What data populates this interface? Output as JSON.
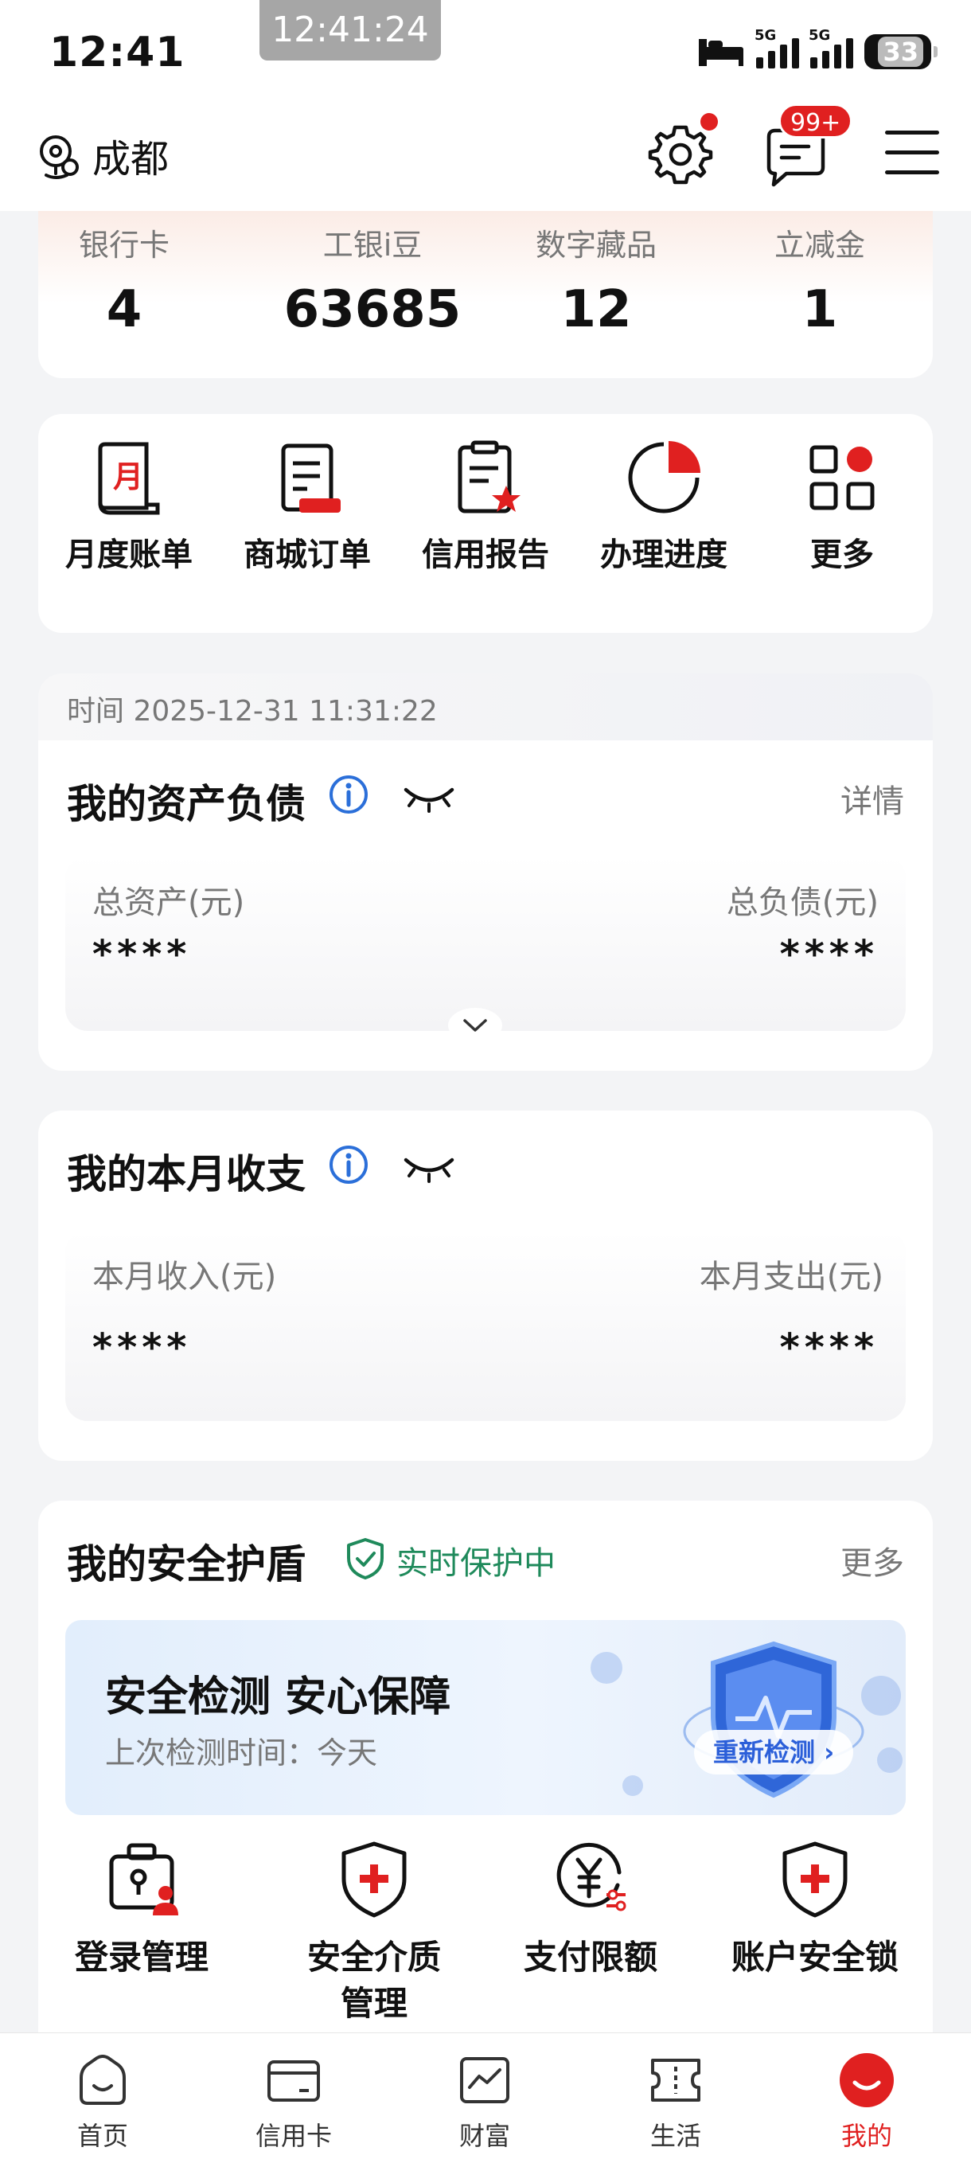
{
  "status_bar": {
    "time": "12:41",
    "clock_overlay": "12:41:24",
    "network_1": "5G",
    "network_2": "5G",
    "battery": "33"
  },
  "header": {
    "city": "成都",
    "message_badge": "99+"
  },
  "stats": [
    {
      "label": "银行卡",
      "value": "4"
    },
    {
      "label": "工银i豆",
      "value": "63685"
    },
    {
      "label": "数字藏品",
      "value": "12"
    },
    {
      "label": "立减金",
      "value": "1"
    }
  ],
  "quick_actions": [
    {
      "label": "月度账单",
      "icon": "monthly-bill-icon"
    },
    {
      "label": "商城订单",
      "icon": "mall-order-icon"
    },
    {
      "label": "信用报告",
      "icon": "credit-report-icon"
    },
    {
      "label": "办理进度",
      "icon": "progress-icon"
    },
    {
      "label": "更多",
      "icon": "more-grid-icon"
    }
  ],
  "timestamp": "时间 2025-12-31 11:31:22",
  "assets": {
    "title": "我的资产负债",
    "detail_link": "详情",
    "total_assets_label": "总资产(元)",
    "total_assets_value": "****",
    "total_debt_label": "总负债(元)",
    "total_debt_value": "****"
  },
  "income": {
    "title": "我的本月收支",
    "income_label": "本月收入(元)",
    "income_value": "****",
    "expense_label": "本月支出(元)",
    "expense_value": "****"
  },
  "security": {
    "title": "我的安全护盾",
    "status": "实时保护中",
    "more_link": "更多",
    "banner_title": "安全检测 安心保障",
    "banner_sub": "上次检测时间：今天",
    "redetect": "重新检测",
    "items": [
      {
        "label": "登录管理",
        "icon": "login-manage-icon"
      },
      {
        "label": "安全介质管理",
        "icon": "security-media-icon"
      },
      {
        "label": "支付限额",
        "icon": "payment-limit-icon"
      },
      {
        "label": "账户安全锁",
        "icon": "account-lock-icon"
      }
    ]
  },
  "tabs": [
    {
      "label": "首页",
      "icon": "home-icon"
    },
    {
      "label": "信用卡",
      "icon": "credit-card-icon"
    },
    {
      "label": "财富",
      "icon": "wealth-icon"
    },
    {
      "label": "生活",
      "icon": "life-ticket-icon"
    },
    {
      "label": "我的",
      "icon": "me-icon"
    }
  ],
  "colors": {
    "brand_red": "#e02020",
    "info_blue": "#2b6fd9",
    "protect_green": "#1f8a5b"
  }
}
